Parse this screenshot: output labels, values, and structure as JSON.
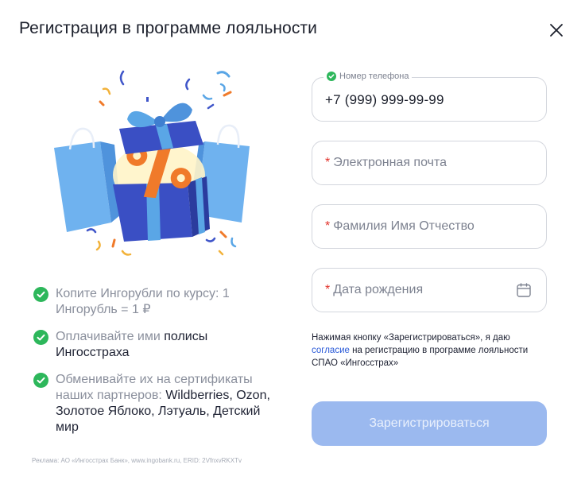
{
  "modal": {
    "title": "Регистрация в программе лояльности",
    "close_icon": "close-icon"
  },
  "illustration": {
    "icon": "gift-box-with-percent-icon"
  },
  "benefits": [
    {
      "muted": "Копите Ингорубли по курсу: 1 Ингорубль = 1 ₽",
      "dark": ""
    },
    {
      "muted": "Оплачивайте ими ",
      "dark": "полисы Ингосстраха"
    },
    {
      "muted": "Обменивайте их на сертификаты наших партнеров: ",
      "dark": "Wildberries, Ozon, Золотое Яблоко, Лэтуаль, Детский мир"
    }
  ],
  "form": {
    "phone": {
      "label": "Номер телефона",
      "value": "+7 (999) 999-99-99"
    },
    "email": {
      "required_mark": "*",
      "placeholder": "Электронная почта"
    },
    "full_name": {
      "required_mark": "*",
      "placeholder": "Фамилия Имя Отчество"
    },
    "birth_date": {
      "required_mark": "*",
      "placeholder": "Дата рождения",
      "icon": "calendar-icon"
    }
  },
  "consent": {
    "before": "Нажимая кнопку «Зарегистрироваться», я даю ",
    "link": "согласие",
    "after": " на регистрацию в программе лояльности СПАО «Ингосстрах»"
  },
  "submit_label": "Зарегистрироваться",
  "footer_note": "Реклама: АО «Ингосстрах Банк», www.ingobank.ru, ERID: 2VfnxvRKXTv",
  "colors": {
    "accent_button": "#9bb9ef",
    "success": "#2db75b",
    "required": "#e2322b",
    "link": "#2a5ad8"
  }
}
